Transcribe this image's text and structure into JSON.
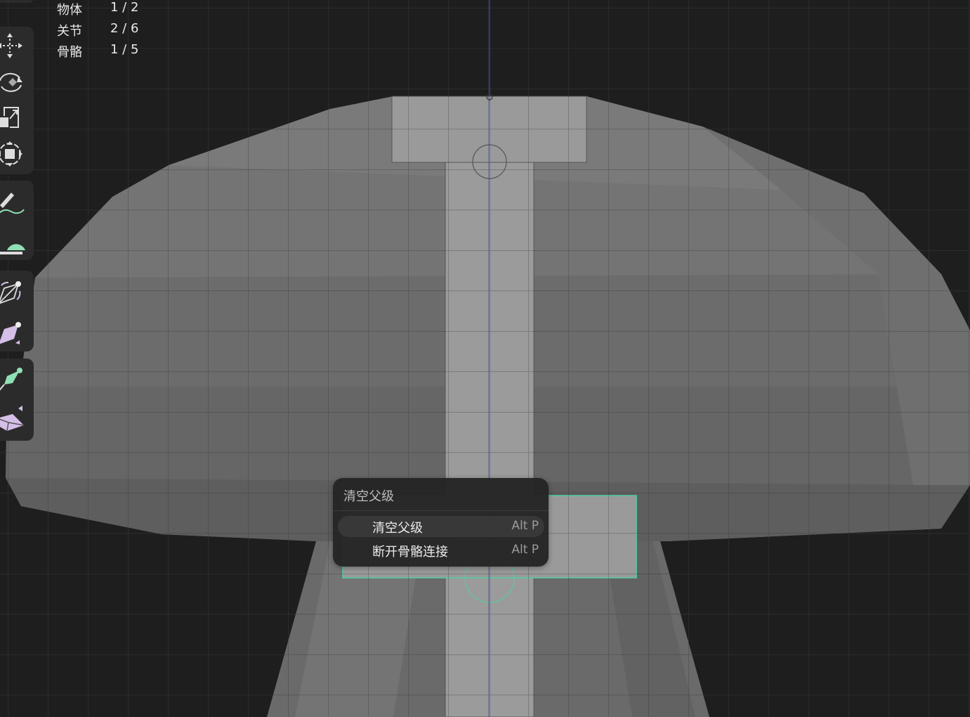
{
  "stats": [
    {
      "label": "物体",
      "value": "1 / 2"
    },
    {
      "label": "关节",
      "value": "2 / 6"
    },
    {
      "label": "骨骼",
      "value": "1 / 5"
    }
  ],
  "toolbar": {
    "tools": [
      {
        "name": "move",
        "icon": "move-icon"
      },
      {
        "name": "rotate",
        "icon": "rotate-icon"
      },
      {
        "name": "scale",
        "icon": "scale-icon"
      },
      {
        "name": "transform",
        "icon": "transform-icon"
      },
      {
        "name": "annotate",
        "icon": "annotate-icon"
      },
      {
        "name": "measure",
        "icon": "measure-icon"
      },
      {
        "name": "roll",
        "icon": "bone-roll-icon"
      },
      {
        "name": "bone-size",
        "icon": "bone-size-icon"
      },
      {
        "name": "bone-envelope",
        "icon": "bone-envelope-icon"
      },
      {
        "name": "extrude",
        "icon": "extrude-icon"
      }
    ]
  },
  "menu": {
    "title": "清空父级",
    "items": [
      {
        "label": "清空父级",
        "shortcut": "Alt P",
        "highlighted": true
      },
      {
        "label": "断开骨骼连接",
        "shortcut": "Alt P",
        "highlighted": false
      }
    ]
  },
  "colors": {
    "background": "#1e1e1e",
    "mesh": "#6e6e6e",
    "bone": "#9b9b9b",
    "selection": "#4fd1a0",
    "axis": "#2f5fd0",
    "accent_purple": "#d5bfe8",
    "accent_green": "#8fe0b4"
  }
}
